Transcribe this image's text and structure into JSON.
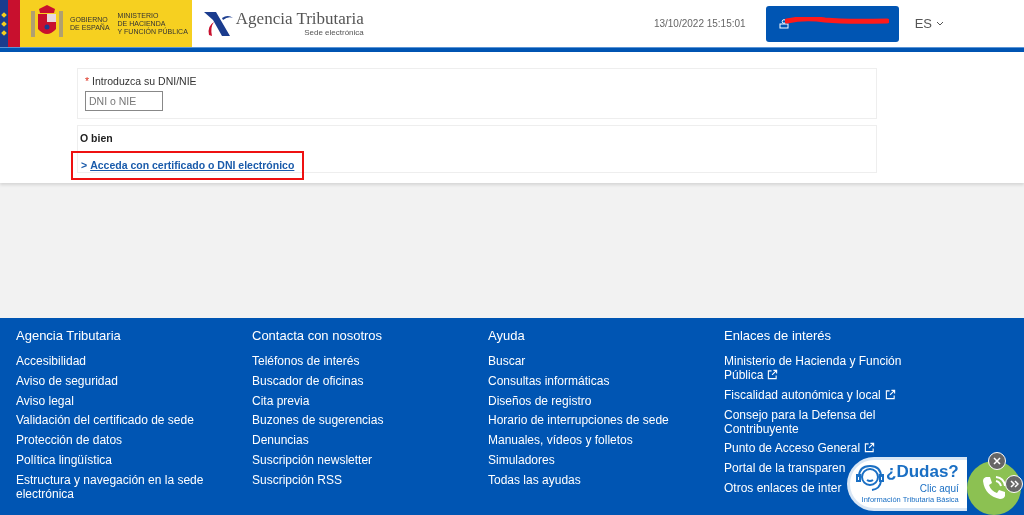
{
  "header": {
    "gov_text": [
      "GOBIERNO",
      "DE ESPAÑA"
    ],
    "ministry_text": [
      "MINISTERIO",
      "DE HACIENDA",
      "Y FUNCIÓN PÚBLICA"
    ],
    "agency_name": "Agencia Tributaria",
    "agency_subtitle": "Sede electrónica",
    "datetime": "13/10/2022 15:15:01",
    "language": "ES"
  },
  "form": {
    "label": "Introduzca su DNI/NIE",
    "required_mark": "*",
    "dni_field": {
      "placeholder": "DNI o NIE"
    },
    "alt_heading": "O bien",
    "cert_link": {
      "prefix": ">",
      "label": "Acceda con certificado o DNI electrónico",
      "highlighted": true
    }
  },
  "footer": {
    "columns": [
      {
        "heading": "Agencia Tributaria",
        "links": [
          {
            "label": "Accesibilidad",
            "external": false
          },
          {
            "label": "Aviso de seguridad",
            "external": false
          },
          {
            "label": "Aviso legal",
            "external": false
          },
          {
            "label": "Validación del certificado de sede",
            "external": false
          },
          {
            "label": "Protección de datos",
            "external": false
          },
          {
            "label": "Política lingüística",
            "external": false
          },
          {
            "label": "Estructura y navegación en la sede electrónica",
            "external": false
          }
        ]
      },
      {
        "heading": "Contacta con nosotros",
        "links": [
          {
            "label": "Teléfonos de interés",
            "external": false
          },
          {
            "label": "Buscador de oficinas",
            "external": false
          },
          {
            "label": "Cita previa",
            "external": false
          },
          {
            "label": "Buzones de sugerencias",
            "external": false
          },
          {
            "label": "Denuncias",
            "external": false
          },
          {
            "label": "Suscripción newsletter",
            "external": false
          },
          {
            "label": "Suscripción RSS",
            "external": false
          }
        ]
      },
      {
        "heading": "Ayuda",
        "links": [
          {
            "label": "Buscar",
            "external": false
          },
          {
            "label": "Consultas informáticas",
            "external": false
          },
          {
            "label": "Diseños de registro",
            "external": false
          },
          {
            "label": "Horario de interrupciones de sede",
            "external": false
          },
          {
            "label": "Manuales, vídeos y folletos",
            "external": false
          },
          {
            "label": "Simuladores",
            "external": false
          },
          {
            "label": "Todas las ayudas",
            "external": false
          }
        ]
      },
      {
        "heading": "Enlaces de interés",
        "links": [
          {
            "label": "Ministerio de Hacienda y Función Pública",
            "external": true
          },
          {
            "label": "Fiscalidad autonómica y local",
            "external": true
          },
          {
            "label": "Consejo para la Defensa del Contribuyente",
            "external": false
          },
          {
            "label": "Punto de Acceso General",
            "external": true
          },
          {
            "label": "Portal de la transparen",
            "external": false
          },
          {
            "label": "Otros enlaces de inter",
            "external": false
          }
        ]
      }
    ]
  },
  "help_widget": {
    "title": "¿Dudas?",
    "action": "Clic aquí",
    "subtitle": "Información Tributaria Básica"
  }
}
